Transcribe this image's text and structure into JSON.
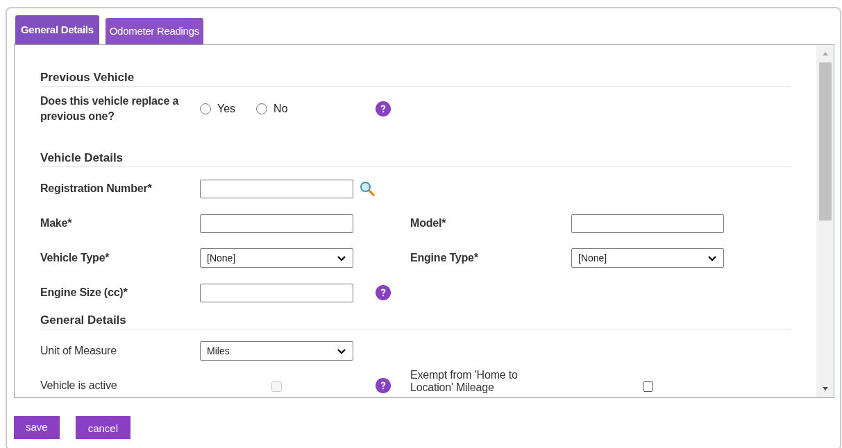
{
  "tabs": [
    {
      "label": "General Details",
      "selected": true
    },
    {
      "label": "Odometer Readings",
      "selected": false
    }
  ],
  "sections": [
    {
      "title": "Previous Vehicle",
      "rows": [
        {
          "cells": [
            {
              "kind": "radio",
              "label": "Does this vehicle replace a previous one?",
              "required": true,
              "options": [
                {
                  "label": "Yes",
                  "selected": false
                },
                {
                  "label": "No",
                  "selected": false
                }
              ]
            },
            {
              "kind": "help"
            }
          ]
        }
      ]
    },
    {
      "title": "Vehicle Details",
      "rows": [
        {
          "cells": [
            {
              "kind": "text",
              "label": "Registration Number*",
              "required": true
            },
            {
              "kind": "search"
            }
          ]
        },
        {
          "cells": [
            {
              "kind": "text",
              "label": "Make*",
              "required": true
            },
            {
              "kind": "text",
              "label": "Model*",
              "required": true
            }
          ]
        },
        {
          "cells": [
            {
              "kind": "select",
              "label": "Vehicle Type*",
              "required": true,
              "value": "[None]"
            },
            {
              "kind": "select",
              "label": "Engine Type*",
              "required": true,
              "value": "[None]"
            }
          ]
        },
        {
          "cells": [
            {
              "kind": "text",
              "label": "Engine Size (cc)*",
              "required": true
            },
            {
              "kind": "help"
            }
          ]
        }
      ]
    },
    {
      "title": "General Details",
      "rows": [
        {
          "cells": [
            {
              "kind": "select",
              "label": "Unit of Measure",
              "required": false,
              "value": "Miles"
            }
          ]
        },
        {
          "cells": [
            {
              "kind": "checkbox",
              "label": "Vehicle is active",
              "required": false,
              "checked": false,
              "disabled": true
            },
            {
              "kind": "help"
            },
            {
              "kind": "checkbox",
              "label": "Exempt from 'Home to Location' Mileage",
              "required": false,
              "checked": false,
              "disabled": false
            }
          ]
        }
      ]
    }
  ],
  "buttons": [
    "save",
    "cancel"
  ]
}
